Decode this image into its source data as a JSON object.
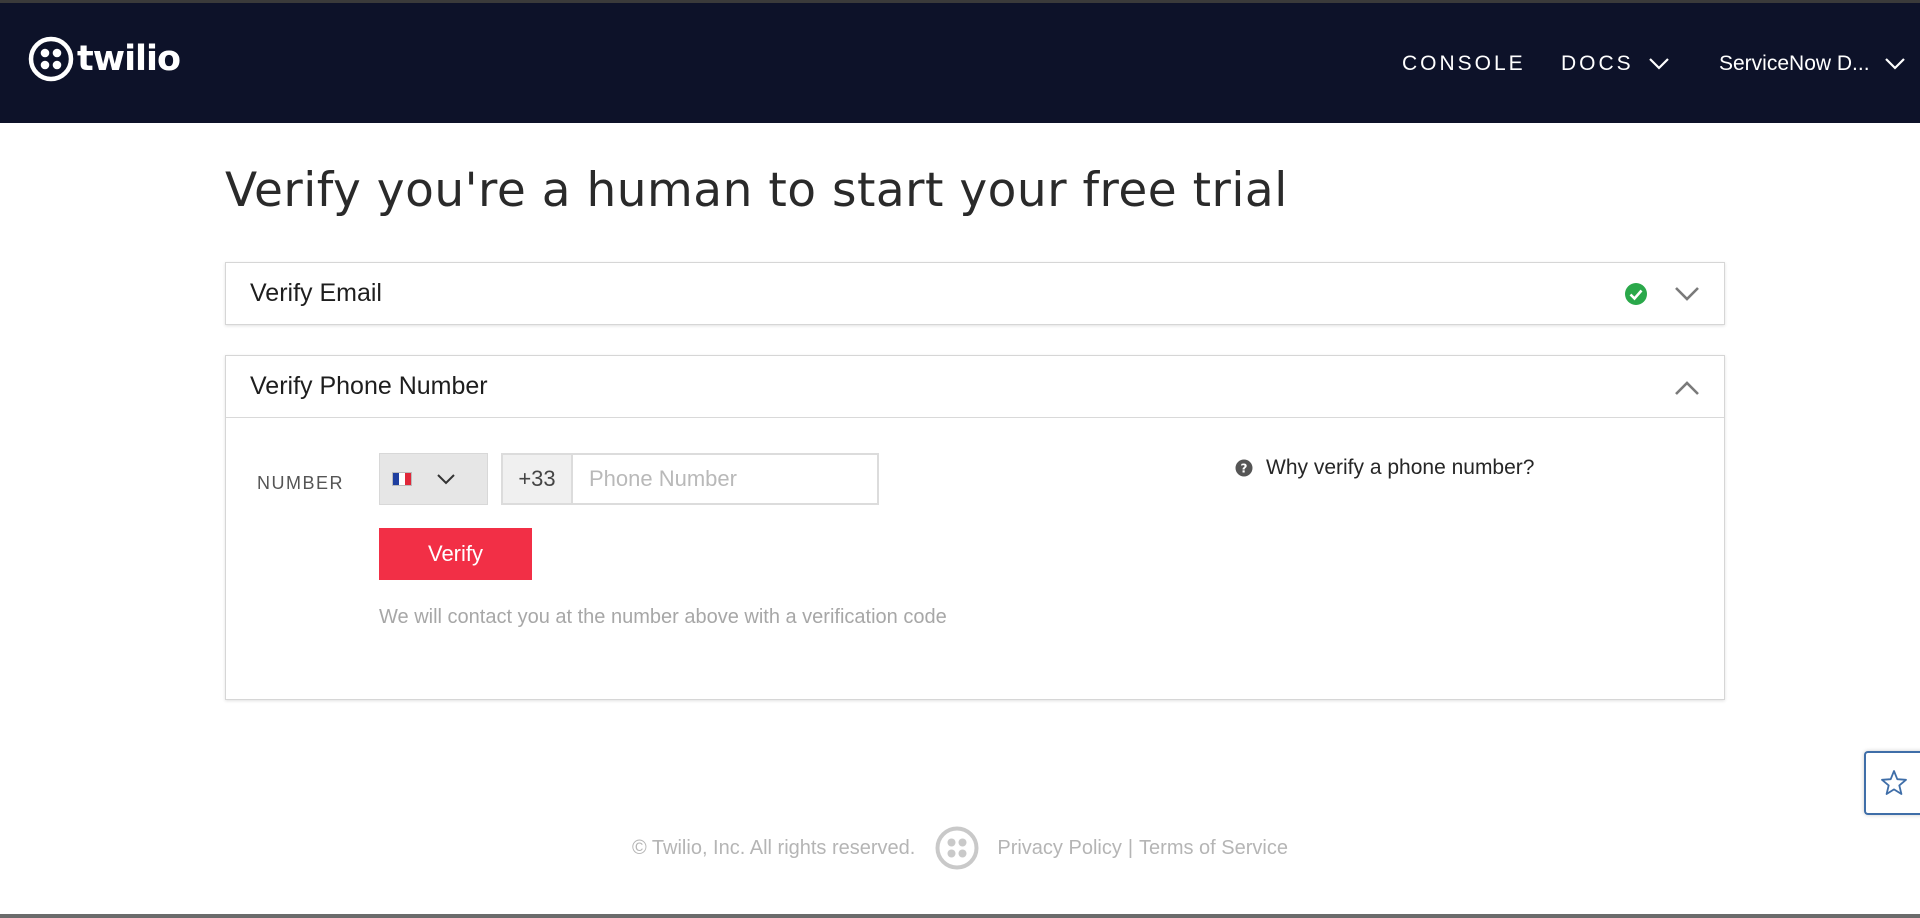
{
  "header": {
    "brand": "twilio",
    "logo_icon": "twilio-logo-icon",
    "nav": {
      "console": "CONSOLE",
      "docs": "DOCS",
      "account": "ServiceNow D..."
    }
  },
  "main": {
    "title": "Verify you're a human to start your free trial",
    "email_panel": {
      "title": "Verify Email",
      "status_icon": "check-circle-icon",
      "status_color": "#2aa84a"
    },
    "phone_panel": {
      "title": "Verify Phone Number",
      "number_label": "NUMBER",
      "country_flag": "france-flag-icon",
      "country_code": "+33",
      "phone_value": "",
      "phone_placeholder": "Phone Number",
      "verify_button": "Verify",
      "helper_text": "We will contact you at the number above with a verification code",
      "why_link": "Why verify a phone number?"
    }
  },
  "footer": {
    "copyright": "© Twilio, Inc. All rights reserved.",
    "privacy": "Privacy Policy",
    "separator": "|",
    "terms": "Terms of Service"
  },
  "colors": {
    "nav_bg": "#0d1229",
    "accent_red": "#f22f46",
    "success_green": "#2aa84a",
    "widget_blue": "#3f6ea8"
  }
}
